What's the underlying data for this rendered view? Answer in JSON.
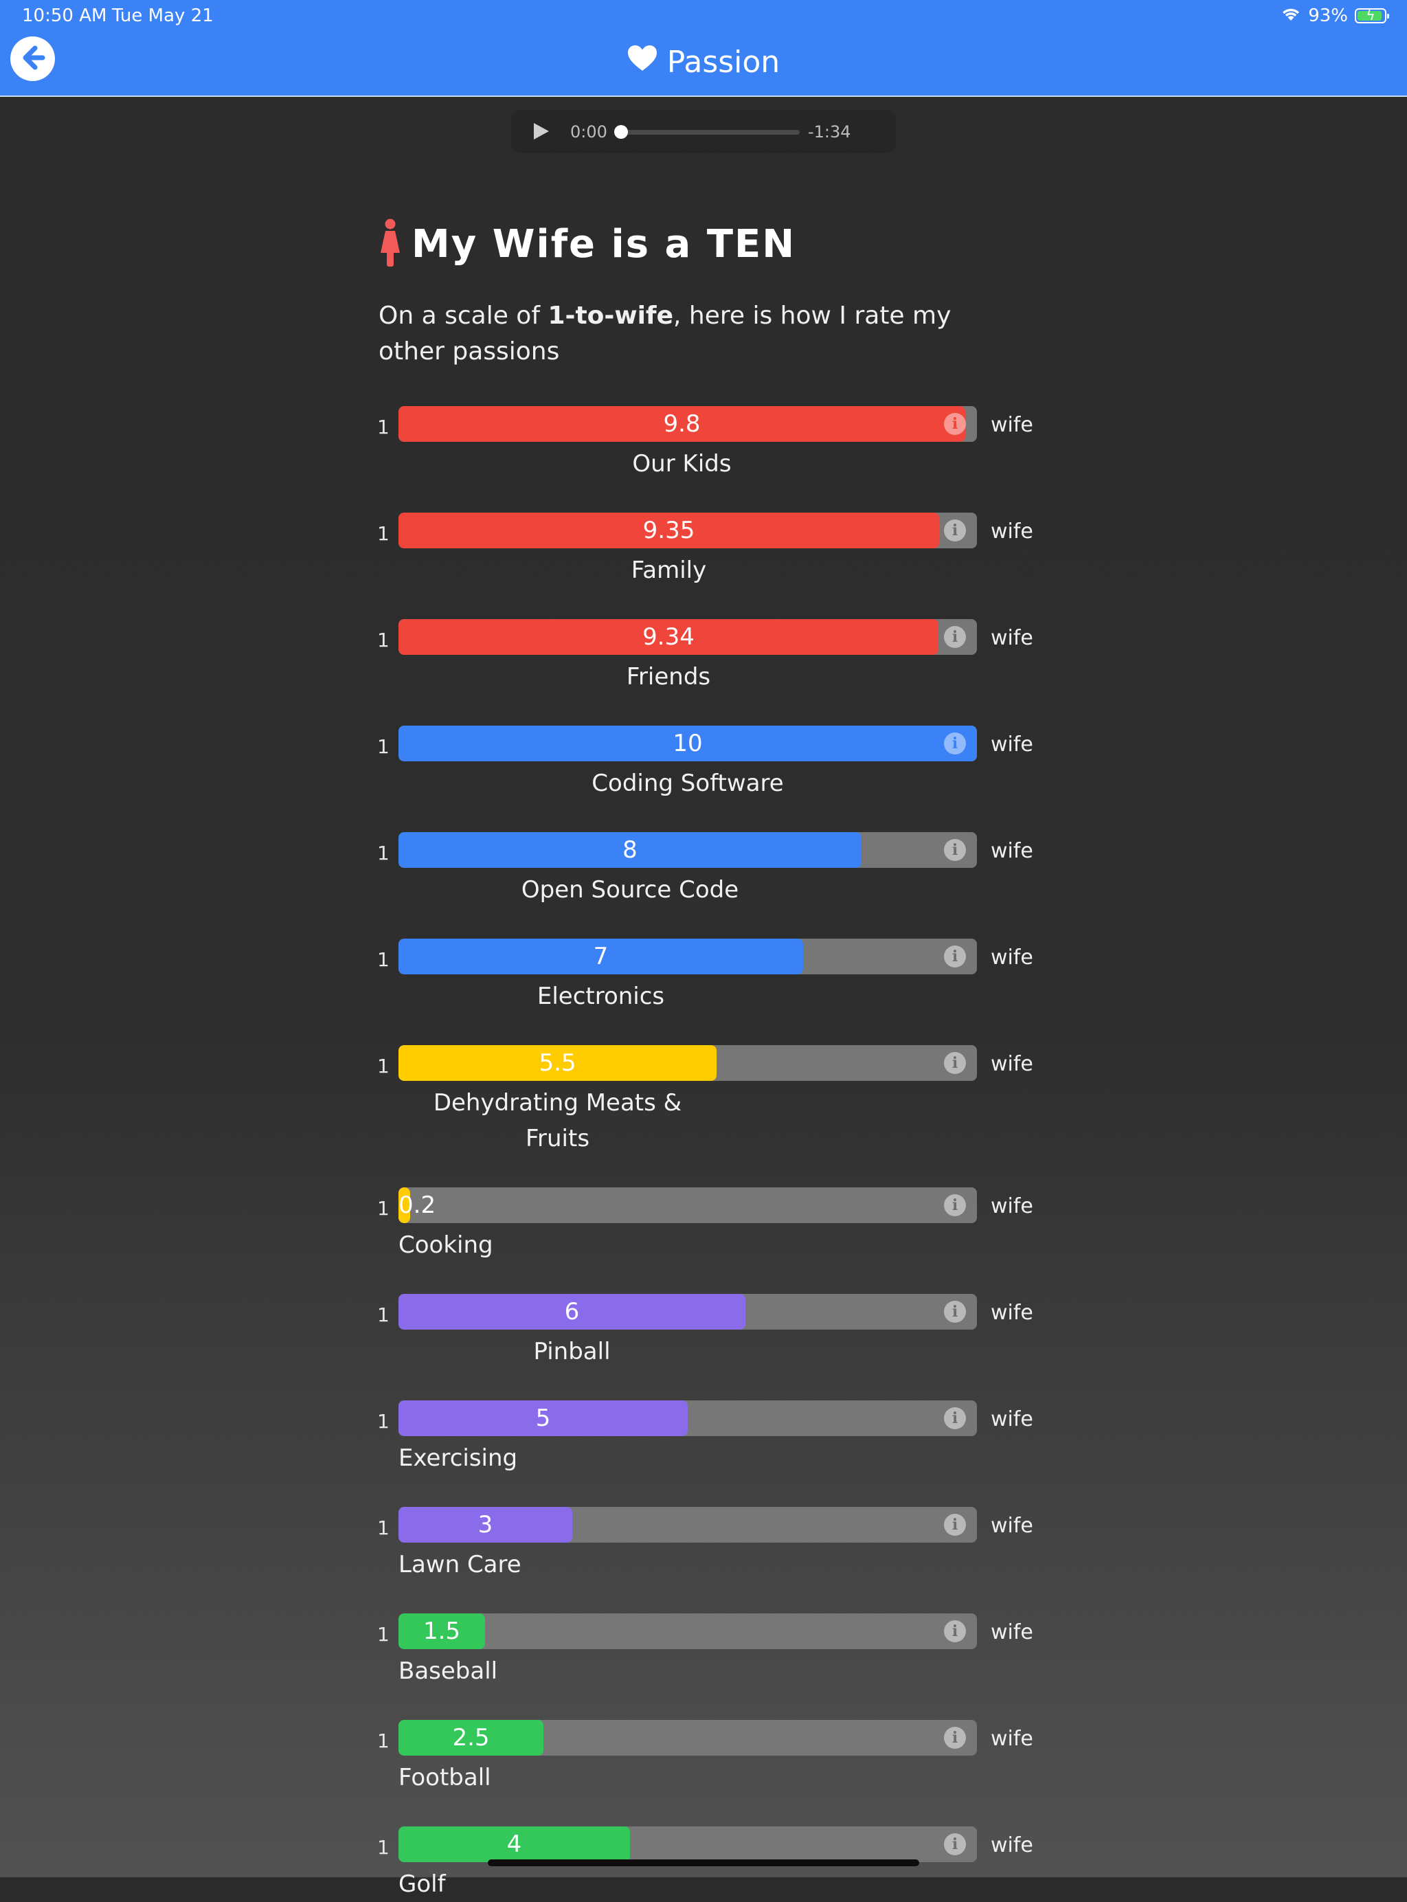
{
  "status": {
    "time": "10:50 AM",
    "date": "Tue May 21",
    "battery": "93%",
    "battery_level": 0.93
  },
  "nav": {
    "title": "Passion",
    "back_icon": "arrow-left-icon",
    "title_icon": "heart-icon"
  },
  "audio": {
    "current": "0:00",
    "remaining": "-1:34",
    "progress": 0
  },
  "heading": {
    "title": "My Wife is a TEN",
    "icon": "female-figure-icon"
  },
  "intro": {
    "prefix": "On a scale of ",
    "bold": "1-to-wife",
    "suffix": ", here is how I rate my other passions"
  },
  "scale": {
    "min_label": "1",
    "max_label": "wife",
    "max": 10
  },
  "colors": {
    "red": "#f0453a",
    "blue": "#3b82f6",
    "yellow": "#ffcc00",
    "purple": "#8a6cea",
    "green": "#34c759",
    "track": "#777777"
  },
  "passions": [
    {
      "value": "9.8",
      "label": "Our Kids",
      "color": "red"
    },
    {
      "value": "9.35",
      "label": "Family",
      "color": "red"
    },
    {
      "value": "9.34",
      "label": "Friends",
      "color": "red"
    },
    {
      "value": "10",
      "label": "Coding Software",
      "color": "blue"
    },
    {
      "value": "8",
      "label": "Open Source Code",
      "color": "blue"
    },
    {
      "value": "7",
      "label": "Electronics",
      "color": "blue"
    },
    {
      "value": "5.5",
      "label": "Dehydrating Meats & Fruits",
      "color": "yellow"
    },
    {
      "value": "0.2",
      "label": "Cooking",
      "color": "yellow"
    },
    {
      "value": "6",
      "label": "Pinball",
      "color": "purple"
    },
    {
      "value": "5",
      "label": "Exercising",
      "color": "purple"
    },
    {
      "value": "3",
      "label": "Lawn Care",
      "color": "purple"
    },
    {
      "value": "1.5",
      "label": "Baseball",
      "color": "green"
    },
    {
      "value": "2.5",
      "label": "Football",
      "color": "green"
    },
    {
      "value": "4",
      "label": "Golf",
      "color": "green"
    }
  ]
}
